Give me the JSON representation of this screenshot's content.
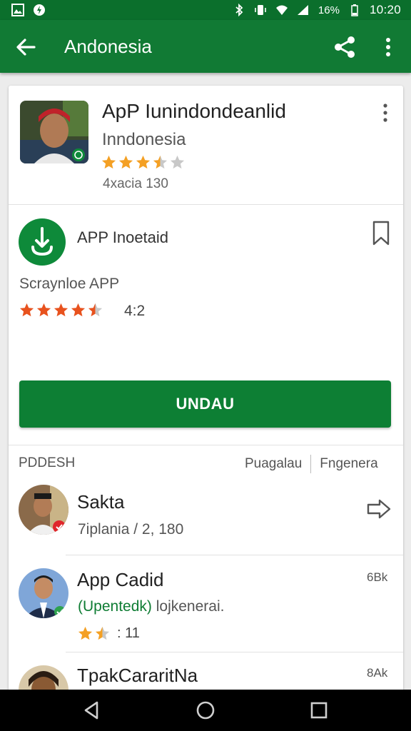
{
  "status_bar": {
    "battery_percent": "16%",
    "time": "10:20",
    "icons": [
      "gallery-icon",
      "shield-icon",
      "bluetooth-icon",
      "vibrate-icon",
      "wifi-icon",
      "signal-icon",
      "battery-icon"
    ]
  },
  "app_bar": {
    "title": "Andonesia"
  },
  "header": {
    "title": "ApP Iunindondeanlid",
    "subtitle": "Inndonesia",
    "rating_stars": 3.5,
    "count_text": "4xacia 130"
  },
  "install": {
    "title": "APP Inoetaid",
    "subtitle": "Scraynloe APP",
    "rating_stars": 4.5,
    "rating_value": "4:2"
  },
  "primary_button": {
    "label": "UNDAU"
  },
  "list_header": {
    "left": "PDDESH",
    "right_a": "Puagalau",
    "right_b": "Fngenera"
  },
  "list_items": [
    {
      "title": "Sakta",
      "subtitle": "7iplania / 2, 180",
      "badge": "red",
      "trailing": "arrow"
    },
    {
      "title": "App Cadid",
      "subtitle_green": "(Upentedk)",
      "subtitle_rest": " lojkenerai.",
      "meta": "6Bk",
      "rating_stars": 1.5,
      "rating_value": ": 11",
      "badge": "green"
    },
    {
      "title": "TpakCararitNa",
      "meta": "8Ak"
    }
  ],
  "colors": {
    "primary_green": "#117a34",
    "status_green": "#0b6f2c",
    "button_green": "#0d7f34",
    "star_orange": "#f4a024",
    "star_red_orange": "#e8521e"
  }
}
